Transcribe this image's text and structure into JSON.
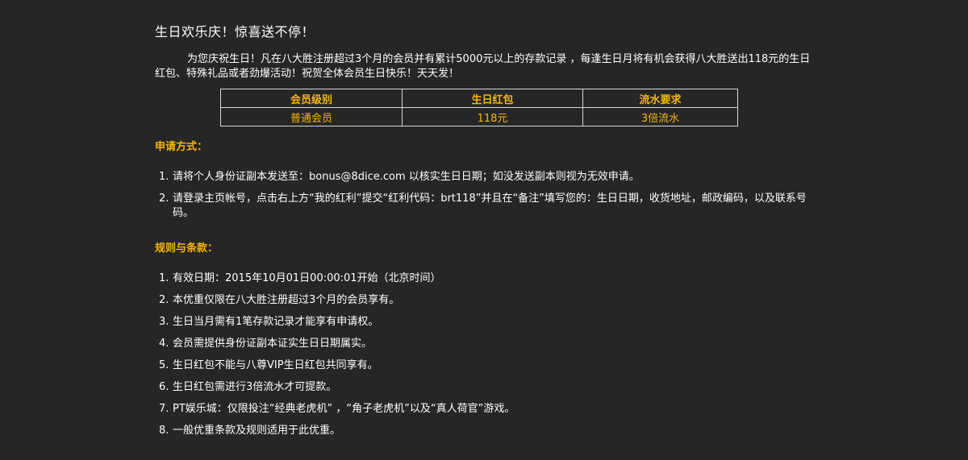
{
  "title": "生日欢乐庆！惊喜送不停！",
  "intro": "为您庆祝生日！凡在八大胜注册超过3个月的会员并有累计5000元以上的存款记录 ，每逢生日月将有机会获得八大胜送出118元的生日红包、特殊礼品或者劲爆活动！祝贺全体会员生日快乐！天天发！",
  "table": {
    "headers": [
      "会员级别",
      "生日红包",
      "流水要求"
    ],
    "rows": [
      [
        "普通会员",
        "118元",
        "3倍流水"
      ]
    ]
  },
  "apply": {
    "heading": "申请方式：",
    "items": [
      {
        "num": "1.",
        "text": "请将个人身份证副本发送至：bonus@8dice.com 以核实生日日期；如没发送副本则视为无效申请。"
      },
      {
        "num": "2.",
        "text": "请登录主页帐号，点击右上方“我的红利”提交“红利代码：brt118”并且在“备注”填写您的：生日日期，收货地址，邮政编码，以及联系号码。"
      }
    ]
  },
  "rules": {
    "heading": "规则与条款：",
    "items": [
      {
        "num": "1.",
        "text": "有效日期：2015年10月01日00:00:01开始（北京时间）"
      },
      {
        "num": "2.",
        "text": "本优重仅限在八大胜注册超过3个月的会员享有。"
      },
      {
        "num": "3.",
        "text": "生日当月需有1笔存款记录才能享有申请权。"
      },
      {
        "num": "4.",
        "text": "会员需提供身份证副本证实生日日期属实。"
      },
      {
        "num": "5.",
        "text": "生日红包不能与八尊VIP生日红包共同享有。"
      },
      {
        "num": "6.",
        "text": "生日红包需进行3倍流水才可提款。"
      },
      {
        "num": "7.",
        "text": "PT娱乐城：仅限投注“经典老虎机” ，“角子老虎机”以及“真人荷官”游戏。"
      },
      {
        "num": "8.",
        "text": "一般优重条款及规则适用于此优重。"
      }
    ]
  },
  "colors": {
    "background": "#262626",
    "accent": "#f5b50a",
    "text": "#ffffff",
    "border": "#d8d8d8"
  }
}
